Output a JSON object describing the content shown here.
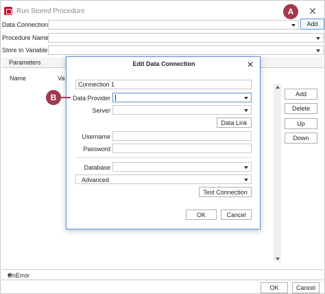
{
  "window": {
    "title": "Run Stored Procedure",
    "close_glyph": "✕"
  },
  "fields": {
    "data_connection": "Data Connection",
    "procedure_name": "Procedure Name",
    "store_in_variable": "Store In Variable"
  },
  "toolbar": {
    "add_label": "Add"
  },
  "parameters": {
    "tab_label": "Parameters",
    "columns": [
      "Name",
      "Va"
    ]
  },
  "side_buttons": {
    "add": "Add",
    "delete": "Delete",
    "up": "Up",
    "down": "Down"
  },
  "onerror": {
    "label": "OnError"
  },
  "footer": {
    "ok": "OK",
    "cancel": "Cancel"
  },
  "dialog": {
    "title": "Edit Data Connection",
    "close_glyph": "✕",
    "connection_name": "Connection 1",
    "data_provider_label": "Data Provider",
    "server_label": "Server",
    "data_link_label": "Data Link",
    "username_label": "Username",
    "password_label": "Password",
    "database_label": "Database",
    "advanced_label": "Advanced",
    "test_connection_label": "Test Connection",
    "ok": "OK",
    "cancel": "Cancel"
  },
  "markers": {
    "a": "A",
    "b": "B"
  },
  "colors": {
    "accent": "#5a8fd0",
    "marker": "#a0394d",
    "app_icon": "#c8102e"
  }
}
